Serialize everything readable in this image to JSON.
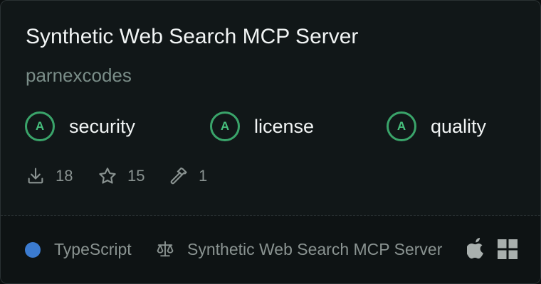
{
  "card": {
    "title": "Synthetic Web Search MCP Server",
    "author": "parnexcodes"
  },
  "badges": [
    {
      "grade": "A",
      "label": "security"
    },
    {
      "grade": "A",
      "label": "license"
    },
    {
      "grade": "A",
      "label": "quality"
    }
  ],
  "stats": {
    "downloads": "18",
    "stars": "15",
    "tools": "1"
  },
  "footer": {
    "language": "TypeScript",
    "license": "Synthetic Web Search MCP Server",
    "platforms": [
      "apple-icon",
      "windows-icon"
    ]
  },
  "colors": {
    "badge_green": "#3aa46a",
    "typescript_blue": "#3b7bd0"
  }
}
